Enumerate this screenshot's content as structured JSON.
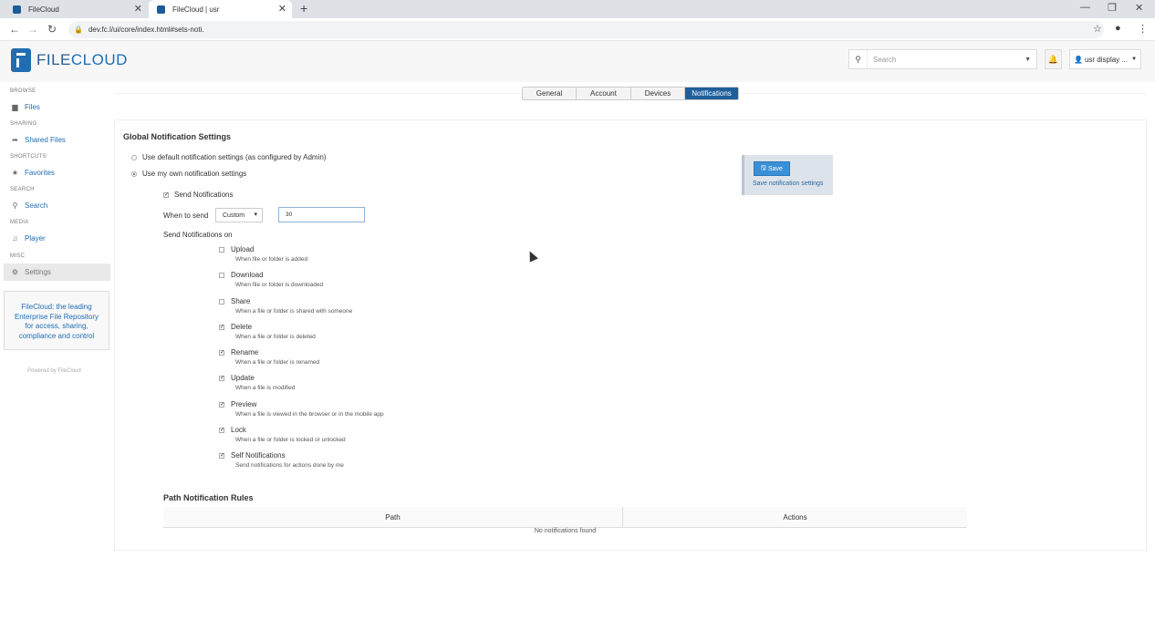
{
  "browser": {
    "tabs": [
      {
        "title": "FileCloud"
      },
      {
        "title": "FileCloud | usr"
      }
    ],
    "url": "dev.fc.l/ui/core/index.html#sets-noti."
  },
  "header": {
    "logo_text_a": "FILE",
    "logo_text_b": "CLOUD",
    "search_placeholder": "Search",
    "user_label": "usr display ..."
  },
  "sidebar": {
    "sections": {
      "browse": "BROWSE",
      "sharing": "SHARING",
      "shortcuts": "SHORTCUTS",
      "search": "SEARCH",
      "media": "MEDIA",
      "misc": "MISC"
    },
    "items": {
      "files": "Files",
      "shared_files": "Shared Files",
      "favorites": "Favorites",
      "search": "Search",
      "player": "Player",
      "settings": "Settings"
    },
    "promo": "FileCloud: the leading Enterprise File Repository for access, sharing, compliance and control",
    "powered": "Powered by FileCloud"
  },
  "tabs": {
    "general": "General",
    "account": "Account",
    "devices": "Devices",
    "notifications": "Notifications"
  },
  "settings": {
    "title": "Global Notification Settings",
    "radio_default": "Use default notification settings (as configured by Admin)",
    "radio_own": "Use my own notification settings",
    "send_notifications": "Send Notifications",
    "when_to_send_label": "When to send",
    "when_to_send_value": "Custom",
    "interval_value": "30",
    "send_on_label": "Send Notifications on",
    "options": [
      {
        "label": "Upload",
        "desc": "When file or folder is added",
        "checked": false
      },
      {
        "label": "Download",
        "desc": "When file or folder is downloaded",
        "checked": false
      },
      {
        "label": "Share",
        "desc": "When a file or folder is shared with someone",
        "checked": false
      },
      {
        "label": "Delete",
        "desc": "When a file or folder is deleted",
        "checked": true
      },
      {
        "label": "Rename",
        "desc": "When a file or folder is renamed",
        "checked": true
      },
      {
        "label": "Update",
        "desc": "When a file is modified",
        "checked": true
      },
      {
        "label": "Preview",
        "desc": "When a file is viewed in the browser or in the mobile app",
        "checked": true
      },
      {
        "label": "Lock",
        "desc": "When a file or folder is locked or unlocked",
        "checked": true
      },
      {
        "label": "Self Notifications",
        "desc": "Send notifications for actions done by me",
        "checked": true
      }
    ],
    "save_label": "Save",
    "save_hint": "Save notification settings"
  },
  "rules": {
    "title": "Path Notification Rules",
    "col_path": "Path",
    "col_actions": "Actions",
    "empty": "No notifications found"
  }
}
